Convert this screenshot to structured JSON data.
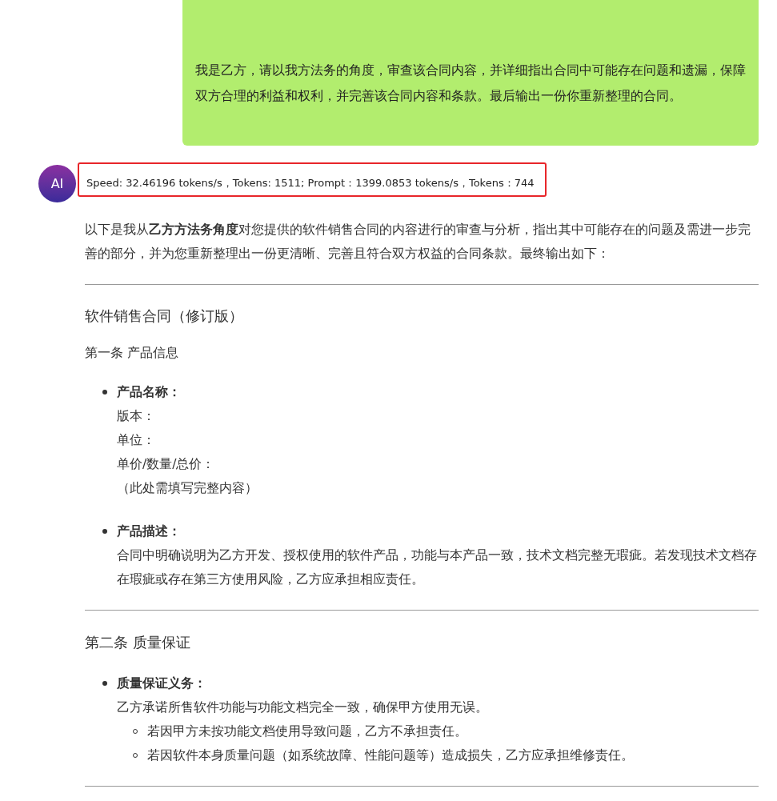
{
  "user_message": {
    "text": "我是乙方，请以我方法务的角度，审查该合同内容，并详细指出合同中可能存在问题和遗漏，保障双方合理的利益和权利，并完善该合同内容和条款。最后输出一份你重新整理的合同。"
  },
  "reply": {
    "avatar": "AI",
    "stats": "Speed: 32.46196 tokens/s，Tokens: 1511; Prompt：1399.0853 tokens/s，Tokens：744",
    "blocks": [
      {
        "kind": "paragraph",
        "text": "以下是我从**乙方方法务角度**对您提供的软件销售合同的内容进行的审查与分析，指出其中可能存在的问题及需进一步完善的部分，并为您重新整理出一份更清晰、完善且符合双方权益的合同条款。最终输出如下："
      },
      {
        "kind": "divider"
      },
      {
        "kind": "title",
        "text": "软件销售合同（修订版）"
      },
      {
        "kind": "subheading",
        "text": "第一条 产品信息"
      },
      {
        "kind": "list",
        "items": [
          {
            "label": "产品名称：",
            "lines": [
              "版本：",
              "单位：",
              "单价/数量/总价：",
              "（此处需填写完整内容）"
            ]
          },
          {
            "label": "产品描述：",
            "lines": [
              "合同中明确说明为乙方开发、授权使用的软件产品，功能与本产品一致，技术文档完整无瑕疵。若发现技术文档存在瑕疵或存在第三方使用风险，乙方应承担相应责任。"
            ]
          }
        ]
      },
      {
        "kind": "divider"
      },
      {
        "kind": "section",
        "text": "第二条 质量保证"
      },
      {
        "kind": "list",
        "items": [
          {
            "label": "质量保证义务：",
            "lines": [
              "乙方承诺所售软件功能与功能文档完全一致，确保甲方使用无误。"
            ],
            "children": [
              "若因甲方未按功能文档使用导致问题，乙方不承担责任。",
              "若因软件本身质量问题（如系统故障、性能问题等）造成损失，乙方应承担维修责任。"
            ]
          }
        ]
      },
      {
        "kind": "divider"
      }
    ]
  }
}
